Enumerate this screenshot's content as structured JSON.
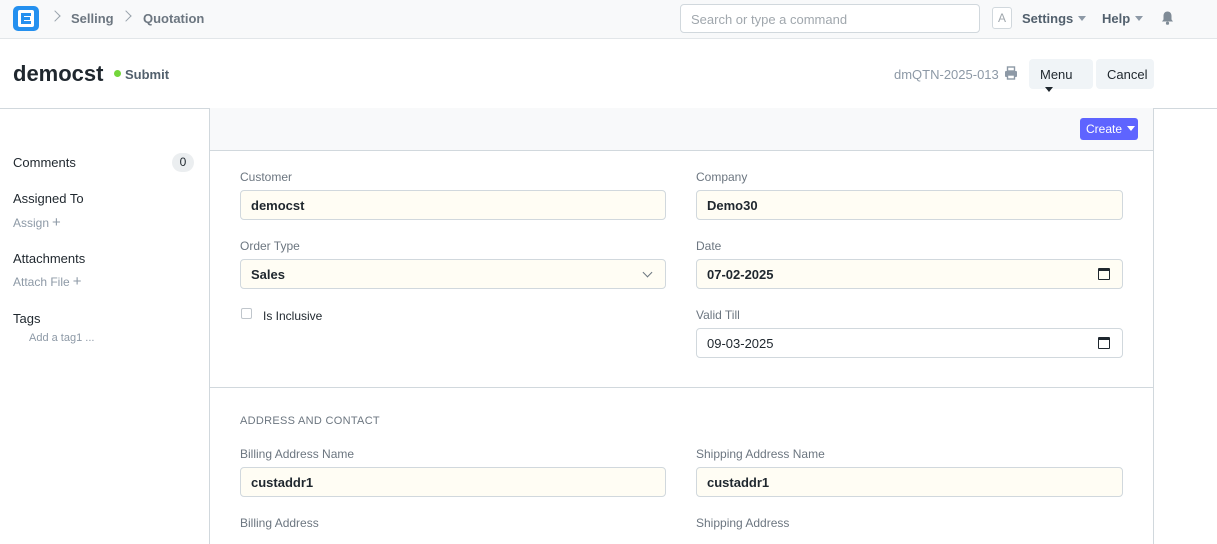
{
  "navbar": {
    "breadcrumbs": [
      "Selling",
      "Quotation"
    ],
    "search_placeholder": "Search or type a command",
    "avatar_letter": "A",
    "settings_label": "Settings",
    "help_label": "Help"
  },
  "header": {
    "title": "democst",
    "status": "Submit",
    "doc_id": "dmQTN-2025-013",
    "menu_label": "Menu",
    "cancel_label": "Cancel"
  },
  "sidebar": {
    "comments_label": "Comments",
    "comments_count": "0",
    "assigned_label": "Assigned To",
    "assign_label": "Assign",
    "attachments_label": "Attachments",
    "attach_label": "Attach File",
    "tags_label": "Tags",
    "add_tag_label": "Add a tag1 ..."
  },
  "toolbar": {
    "create_label": "Create"
  },
  "form": {
    "customer_label": "Customer",
    "customer_value": "democst",
    "company_label": "Company",
    "company_value": "Demo30",
    "order_type_label": "Order Type",
    "order_type_value": "Sales",
    "date_label": "Date",
    "date_value": "07-02-2025",
    "is_inclusive_label": "Is Inclusive",
    "valid_till_label": "Valid Till",
    "valid_till_value": "09-03-2025",
    "section_address": "ADDRESS AND CONTACT",
    "billing_name_label": "Billing Address Name",
    "billing_name_value": "custaddr1",
    "shipping_name_label": "Shipping Address Name",
    "shipping_name_value": "custaddr1",
    "billing_address_label": "Billing Address",
    "shipping_address_label": "Shipping Address"
  },
  "colors": {
    "accent": "#5e64ff",
    "logo": "#2490ef",
    "status": "#74d63b"
  },
  "icons": [
    "app-logo-icon",
    "bell-icon",
    "printer-icon",
    "calendar-icon",
    "chevron-down-icon",
    "plus-icon"
  ]
}
